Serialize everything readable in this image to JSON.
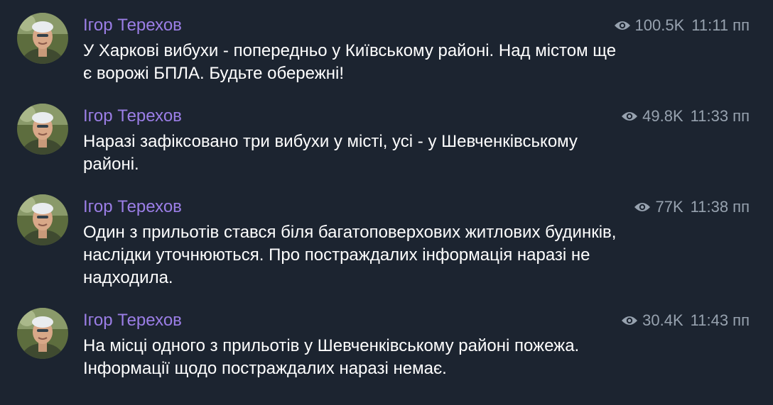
{
  "colors": {
    "background": "#1c2430",
    "author": "#9b7ee6",
    "meta": "#97a2af",
    "text": "#ffffff"
  },
  "icons": {
    "views": "eye-icon",
    "avatar": "profile-photo"
  },
  "messages": [
    {
      "author": "Ігор Терехов",
      "views": "100.5K",
      "time": "11:11 пп",
      "text": "У Харкові вибухи - попередньо у Київському районі. Над містом ще є ворожі БПЛА. Будьте обережні!"
    },
    {
      "author": "Ігор Терехов",
      "views": "49.8K",
      "time": "11:33 пп",
      "text": "Наразі зафіксовано три вибухи у місті, усі - у Шевченківському районі."
    },
    {
      "author": "Ігор Терехов",
      "views": "77K",
      "time": "11:38 пп",
      "text": "Один з прильотів стався біля багатоповерхових житлових будинків, наслідки уточнюються. Про постраждалих інформація наразі не надходила."
    },
    {
      "author": "Ігор Терехов",
      "views": "30.4K",
      "time": "11:43 пп",
      "text": "На місці одного з прильотів у Шевченківському районі пожежа. Інформації щодо постраждалих наразі немає."
    }
  ]
}
